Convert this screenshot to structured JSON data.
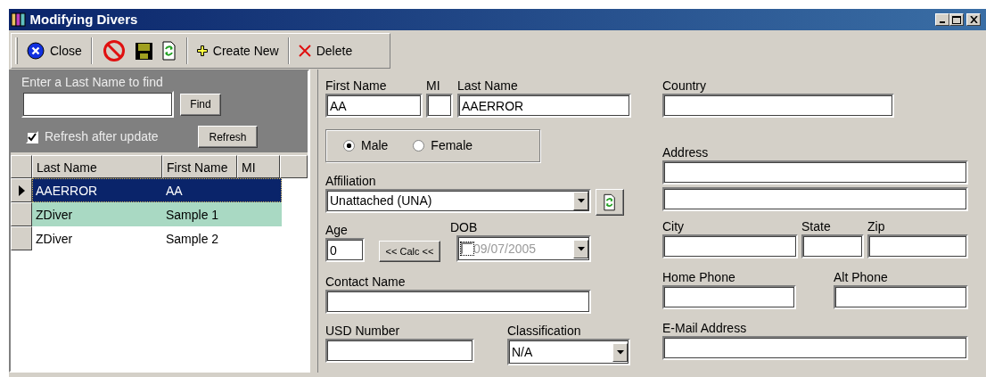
{
  "window": {
    "title": "Modifying Divers"
  },
  "toolbar": {
    "groups": [
      [
        {
          "kind": "labeled",
          "label": "Close"
        }
      ],
      [
        {
          "kind": "icon"
        },
        {
          "kind": "icon"
        },
        {
          "kind": "icon"
        }
      ],
      [
        {
          "kind": "labeled",
          "label": "Create New"
        }
      ],
      [
        {
          "kind": "labeled",
          "label": "Delete"
        }
      ]
    ]
  },
  "search": {
    "label": "Enter a Last Name to find",
    "find_button": "Find",
    "refresh_option": {
      "label": "Refresh after update",
      "checked": true
    },
    "refresh_button": "Refresh"
  },
  "grid": {
    "columns": [
      "Last Name",
      "First Name",
      "MI"
    ],
    "rows": [
      {
        "last_name": "AAERROR",
        "first_name": "AA",
        "selected": true,
        "highlighted": false
      },
      {
        "last_name": "ZDiver",
        "first_name": "Sample 1",
        "selected": false,
        "highlighted": true
      },
      {
        "last_name": "ZDiver",
        "first_name": "Sample 2",
        "selected": false,
        "highlighted": false
      }
    ]
  },
  "form": {
    "first_name": {
      "label": "First Name",
      "value": "AA"
    },
    "mi": {
      "label": "MI"
    },
    "last_name": {
      "label": "Last Name",
      "value": "AAERROR"
    },
    "gender": [
      {
        "label": "Male",
        "selected": true
      },
      {
        "label": "Female",
        "selected": false
      }
    ],
    "affiliation": {
      "label": "Affiliation",
      "value": "Unattached (UNA)"
    },
    "age": {
      "label": "Age",
      "value": "0"
    },
    "calc_button": "<< Calc <<",
    "dob": {
      "label": "DOB",
      "value": "09/07/2005",
      "checked": false
    },
    "contact_name": {
      "label": "Contact Name"
    },
    "usd_number": {
      "label": "USD Number"
    },
    "classification": {
      "label": "Classification",
      "value": "N/A"
    },
    "country": {
      "label": "Country"
    },
    "address": {
      "label": "Address"
    },
    "city": {
      "label": "City"
    },
    "state": {
      "label": "State"
    },
    "zip": {
      "label": "Zip"
    },
    "home_phone": {
      "label": "Home Phone"
    },
    "alt_phone": {
      "label": "Alt Phone"
    },
    "email": {
      "label": "E-Mail Address"
    }
  }
}
